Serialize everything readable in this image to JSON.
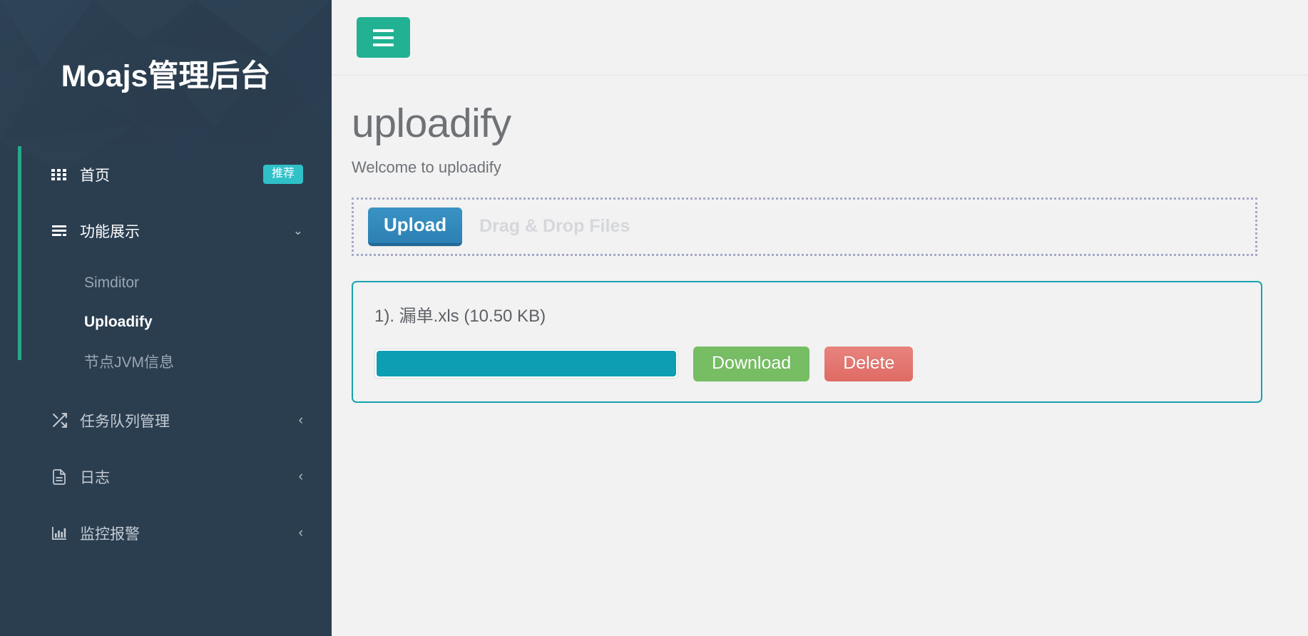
{
  "sidebar": {
    "brand": "Moajs管理后台",
    "accent_color": "#26a987",
    "background_color": "#2b3e50",
    "items": [
      {
        "label": "首页",
        "icon": "grid-icon",
        "badge": "推荐",
        "badge_color": "#2fc0c8"
      },
      {
        "label": "功能展示",
        "icon": "list-icon",
        "caret": "⌄"
      },
      {
        "label": "任务队列管理",
        "icon": "shuffle-icon",
        "caret": "‹"
      },
      {
        "label": "日志",
        "icon": "document-icon",
        "caret": "‹"
      },
      {
        "label": "监控报警",
        "icon": "bar-chart-icon",
        "caret": "‹"
      }
    ],
    "submenu": [
      {
        "label": "Simditor",
        "current": false
      },
      {
        "label": "Uploadify",
        "current": true
      },
      {
        "label": "节点JVM信息",
        "current": false
      }
    ]
  },
  "topbar": {
    "menu_toggle_icon": "hamburger-icon",
    "menu_toggle_color": "#22b192"
  },
  "main": {
    "title": "uploadify",
    "subtitle": "Welcome to uploadify",
    "dropzone": {
      "upload_button": "Upload",
      "drag_drop_text": "Drag & Drop Files",
      "border_color": "#a5a8ca",
      "upload_button_color": "#2c80b4"
    },
    "files": [
      {
        "name": "1). 漏单.xls (10.50 KB)",
        "progress_percent": 100,
        "progress_color": "#0e9eb3",
        "download_label": "Download",
        "delete_label": "Delete",
        "download_color": "#76bd63",
        "delete_color": "#df6b64"
      }
    ]
  }
}
